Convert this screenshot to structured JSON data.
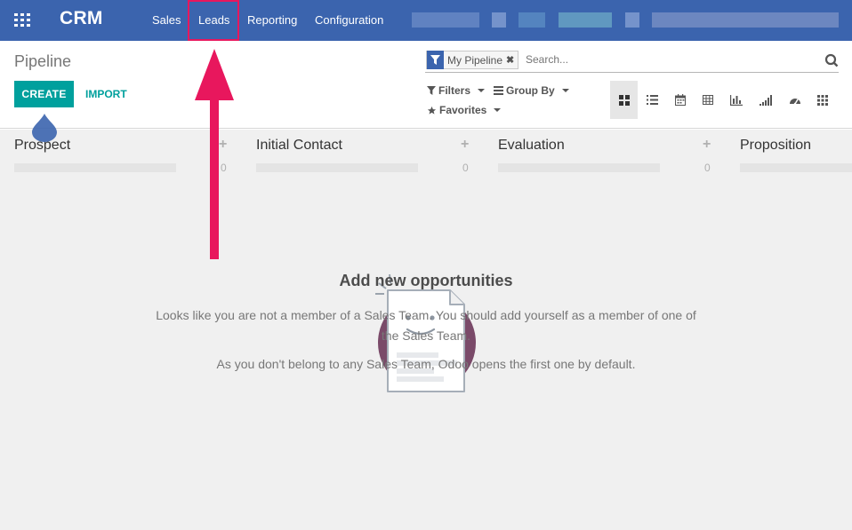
{
  "navbar": {
    "brand": "CRM",
    "menu": [
      "Sales",
      "Leads",
      "Reporting",
      "Configuration"
    ],
    "highlighted_item": "Leads"
  },
  "control_panel": {
    "breadcrumb": "Pipeline",
    "create_label": "CREATE",
    "import_label": "IMPORT",
    "search": {
      "facet": "My Pipeline",
      "placeholder": "Search..."
    },
    "filters_label": "Filters",
    "groupby_label": "Group By",
    "favorites_label": "Favorites",
    "views": [
      "kanban-icon",
      "list-icon",
      "calendar-icon",
      "pivot-icon",
      "graph-icon",
      "cohort-icon",
      "dashboard-icon",
      "grid-icon"
    ],
    "active_view": "kanban-icon"
  },
  "kanban": {
    "columns": [
      {
        "title": "Prospect",
        "count": "0"
      },
      {
        "title": "Initial Contact",
        "count": "0"
      },
      {
        "title": "Evaluation",
        "count": "0"
      },
      {
        "title": "Proposition",
        "count": ""
      }
    ]
  },
  "helper": {
    "title": "Add new opportunities",
    "paragraph1": "Looks like you are not a member of a Sales Team. You should add yourself as a member of one of the Sales Team.",
    "paragraph2": "As you don't belong to any Sales Team, Odoo opens the first one by default."
  },
  "colors": {
    "navbar": "#3b64ae",
    "accent": "#00a09d",
    "highlight": "#e8175d",
    "illustration_circle": "#7a4a69"
  }
}
